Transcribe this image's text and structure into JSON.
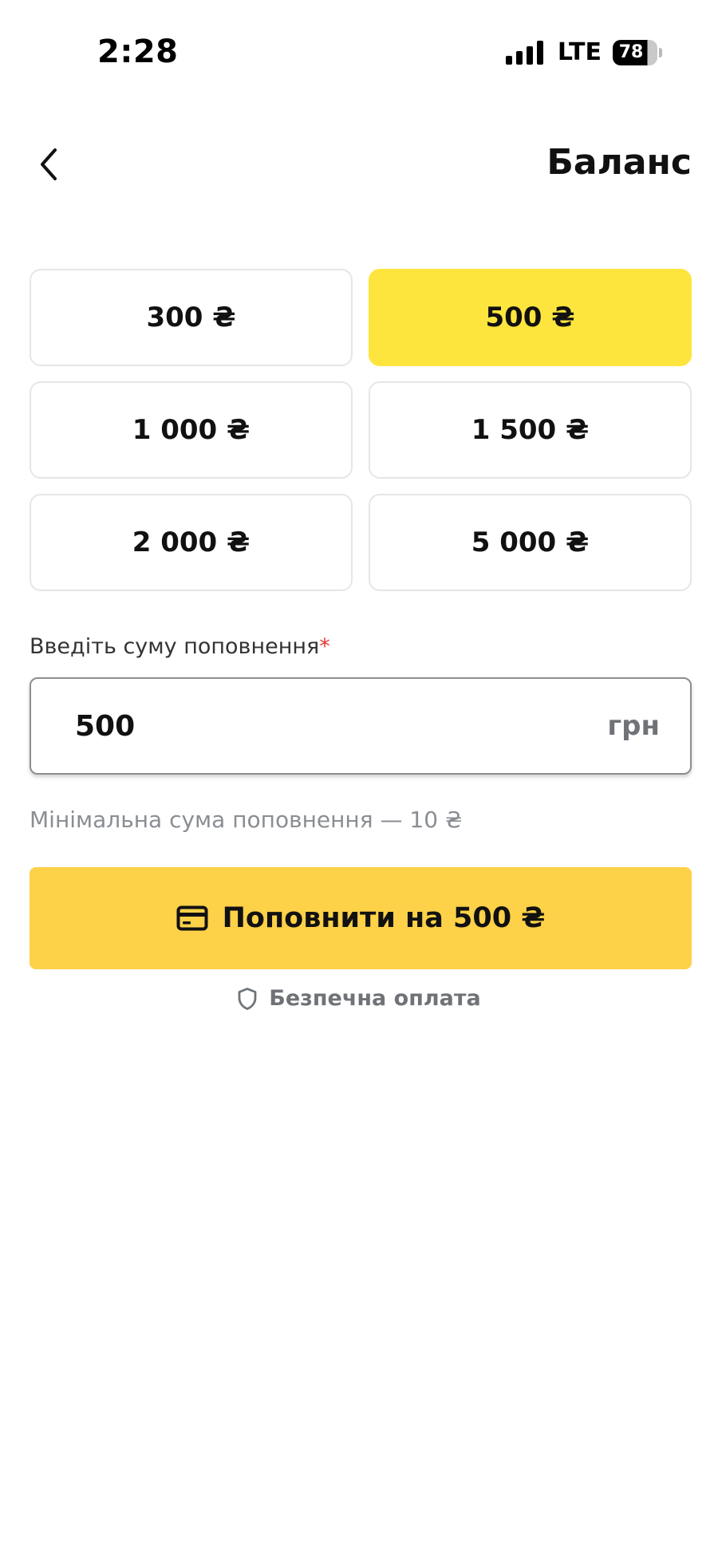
{
  "status_bar": {
    "time": "2:28",
    "network": "LTE",
    "battery": "78",
    "battery_level_percent": 78,
    "signal_bars": 4
  },
  "header": {
    "title": "Баланс",
    "back_icon": "chevron-left-icon"
  },
  "amounts": {
    "options": [
      "300 ₴",
      "500 ₴",
      "1 000 ₴",
      "1 500 ₴",
      "2 000 ₴",
      "5 000 ₴"
    ],
    "selected": "500 ₴"
  },
  "input": {
    "label": "Введіть суму поповнення",
    "required_mark": "*",
    "value": "500",
    "currency": "грн"
  },
  "min_note": "Мінімальна сума поповнення — 10 ₴",
  "topup_button": {
    "label": "Поповнити на 500 ₴",
    "icon": "credit-card-icon"
  },
  "secure": {
    "label": "Безпечна оплата",
    "icon": "shield-icon"
  },
  "colors": {
    "selected_option": "#fde53e",
    "primary_button": "#fdd148",
    "required": "#e53935",
    "muted_text": "#8a8e93"
  }
}
